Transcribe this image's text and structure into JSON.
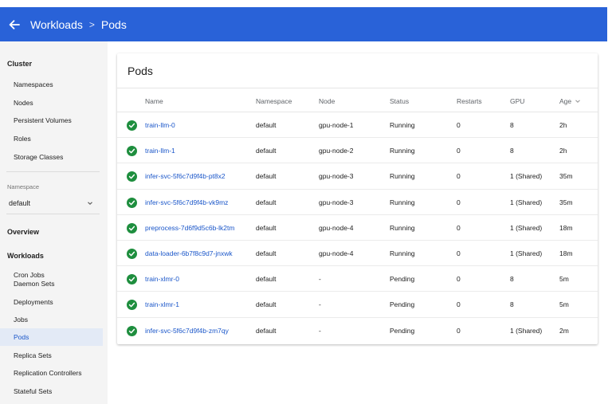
{
  "header": {
    "crumbs": [
      "Workloads",
      "Pods"
    ],
    "separator": ">"
  },
  "sidebar": {
    "cluster_title": "Cluster",
    "cluster_items": [
      "Namespaces",
      "Nodes",
      "Persistent Volumes",
      "Roles",
      "Storage Classes"
    ],
    "namespace_label": "Namespace",
    "namespace_value": "default",
    "overview": "Overview",
    "workloads_title": "Workloads",
    "workload_items": [
      "Cron Jobs",
      "Daemon Sets",
      "Deployments",
      "Jobs",
      "Pods",
      "Replica Sets",
      "Replication Controllers",
      "Stateful Sets"
    ],
    "active_item": "Pods"
  },
  "card": {
    "title": "Pods",
    "columns": [
      "Name",
      "Namespace",
      "Node",
      "Status",
      "Restarts",
      "GPU",
      "Age"
    ],
    "rows": [
      {
        "name": "train-llm-0",
        "namespace": "default",
        "node": "gpu-node-1",
        "status": "Running",
        "restarts": "0",
        "gpu": "8",
        "age": "2h"
      },
      {
        "name": "train-llm-1",
        "namespace": "default",
        "node": "gpu-node-2",
        "status": "Running",
        "restarts": "0",
        "gpu": "8",
        "age": "2h"
      },
      {
        "name": "infer-svc-5f6c7d9f4b-pt8x2",
        "namespace": "default",
        "node": "gpu-node-3",
        "status": "Running",
        "restarts": "0",
        "gpu": "1 (Shared)",
        "age": "35m"
      },
      {
        "name": "infer-svc-5f6c7d9f4b-vk9mz",
        "namespace": "default",
        "node": "gpu-node-3",
        "status": "Running",
        "restarts": "0",
        "gpu": "1 (Shared)",
        "age": "35m"
      },
      {
        "name": "preprocess-7d6f9d5c6b-lk2tm",
        "namespace": "default",
        "node": "gpu-node-4",
        "status": "Running",
        "restarts": "0",
        "gpu": "1 (Shared)",
        "age": "18m"
      },
      {
        "name": "data-loader-6b7f8c9d7-jnxwk",
        "namespace": "default",
        "node": "gpu-node-4",
        "status": "Running",
        "restarts": "0",
        "gpu": "1 (Shared)",
        "age": "18m"
      },
      {
        "name": "train-xlmr-0",
        "namespace": "default",
        "node": "-",
        "status": "Pending",
        "restarts": "0",
        "gpu": "8",
        "age": "5m"
      },
      {
        "name": "train-xlmr-1",
        "namespace": "default",
        "node": "-",
        "status": "Pending",
        "restarts": "0",
        "gpu": "8",
        "age": "5m"
      },
      {
        "name": "infer-svc-5f6c7d9f4b-zm7qy",
        "namespace": "default",
        "node": "-",
        "status": "Pending",
        "restarts": "0",
        "gpu": "1 (Shared)",
        "age": "2m"
      }
    ]
  },
  "colors": {
    "accent": "#2962d8",
    "link": "#1a56c9",
    "ok": "#1e8e3e"
  },
  "icons": {
    "back": "arrow-left-icon",
    "status": "check-circle-icon",
    "sort": "chevron-down-icon",
    "select": "chevron-down-icon"
  }
}
